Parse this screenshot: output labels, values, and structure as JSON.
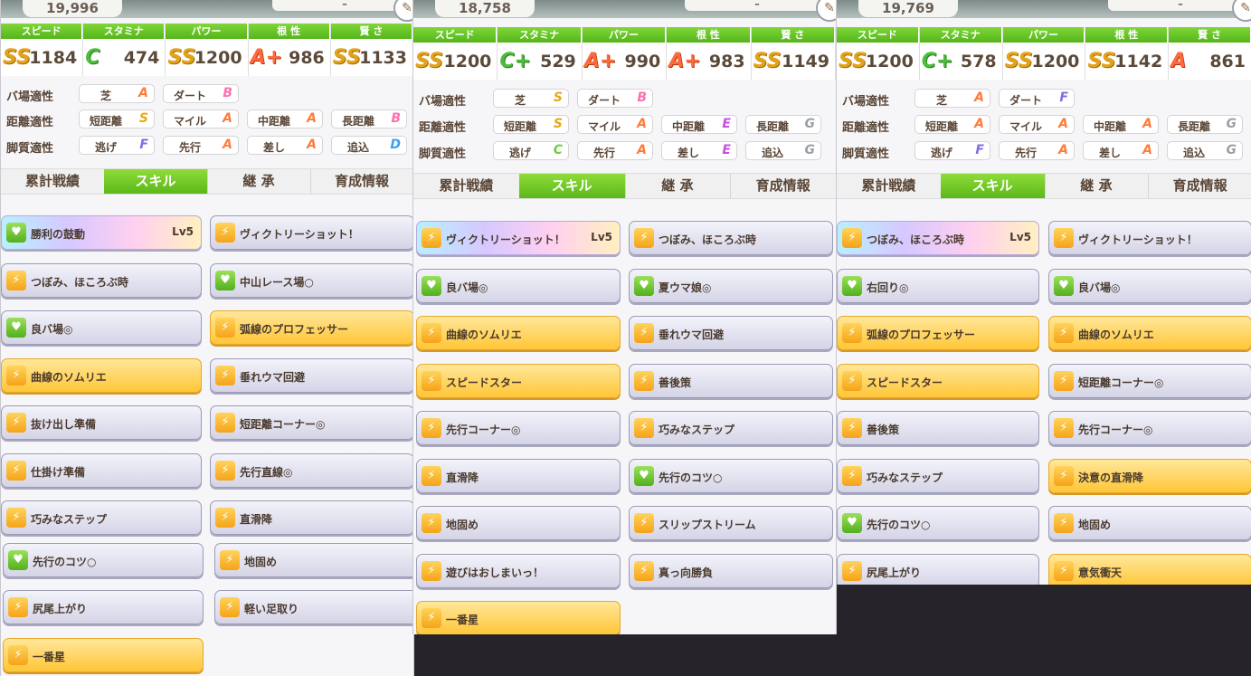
{
  "panels": [
    {
      "score": "19,996",
      "dash": "–",
      "stat_headers": [
        "スピード",
        "スタミナ",
        "パワー",
        "根 性",
        "賢 さ"
      ],
      "stats": [
        {
          "grade": "SS",
          "value": "1184",
          "tone": "gold"
        },
        {
          "grade": "C",
          "value": "474",
          "tone": "gr"
        },
        {
          "grade": "SS",
          "value": "1200",
          "tone": "gold"
        },
        {
          "grade": "A+",
          "value": "986",
          "tone": "or"
        },
        {
          "grade": "SS",
          "value": "1133",
          "tone": "gold"
        }
      ],
      "apt_labels": [
        "バ場適性",
        "距離適性",
        "脚質適性"
      ],
      "apt_rows": [
        [
          {
            "name": "芝",
            "grade": "A"
          },
          {
            "name": "ダート",
            "grade": "B"
          }
        ],
        [
          {
            "name": "短距離",
            "grade": "S"
          },
          {
            "name": "マイル",
            "grade": "A"
          },
          {
            "name": "中距離",
            "grade": "A"
          },
          {
            "name": "長距離",
            "grade": "B"
          }
        ],
        [
          {
            "name": "逃げ",
            "grade": "F"
          },
          {
            "name": "先行",
            "grade": "A"
          },
          {
            "name": "差し",
            "grade": "A"
          },
          {
            "name": "追込",
            "grade": "D"
          }
        ]
      ],
      "tabs": [
        "累計戦績",
        "スキル",
        "継 承",
        "育成情報"
      ],
      "skills": [
        {
          "name": "勝利の鼓動",
          "level": "Lv5",
          "style": "rainbow",
          "icon": "green"
        },
        {
          "name": "ヴィクトリーショット！",
          "style": "plain"
        },
        {
          "name": "つぼみ、ほころぶ時",
          "style": "plain"
        },
        {
          "name": "中山レース場○",
          "style": "plain",
          "icon": "green"
        },
        {
          "name": "良バ場◎",
          "style": "plain",
          "icon": "green"
        },
        {
          "name": "弧線のプロフェッサー",
          "style": "gold"
        },
        {
          "name": "曲線のソムリエ",
          "style": "gold"
        },
        {
          "name": "垂れウマ回避",
          "style": "plain"
        },
        {
          "name": "抜け出し準備",
          "style": "plain"
        },
        {
          "name": "短距離コーナー◎",
          "style": "plain"
        },
        {
          "name": "仕掛け準備",
          "style": "plain"
        },
        {
          "name": "先行直線◎",
          "style": "plain"
        },
        {
          "name": "巧みなステップ",
          "style": "plain"
        },
        {
          "name": "直滑降",
          "style": "plain"
        },
        {
          "name": "先行のコツ○",
          "style": "plain",
          "icon": "green"
        },
        {
          "name": "地固め",
          "style": "plain"
        },
        {
          "name": "尻尾上がり",
          "style": "plain"
        },
        {
          "name": "軽い足取り",
          "style": "plain"
        },
        {
          "name": "一番星",
          "style": "gold"
        }
      ]
    },
    {
      "score": "18,758",
      "dash": "–",
      "stat_headers": [
        "スピード",
        "スタミナ",
        "パワー",
        "根 性",
        "賢 さ"
      ],
      "stats": [
        {
          "grade": "SS",
          "value": "1200",
          "tone": "gold"
        },
        {
          "grade": "C+",
          "value": "529",
          "tone": "gr"
        },
        {
          "grade": "A+",
          "value": "990",
          "tone": "or"
        },
        {
          "grade": "A+",
          "value": "983",
          "tone": "or"
        },
        {
          "grade": "SS",
          "value": "1149",
          "tone": "gold"
        }
      ],
      "apt_labels": [
        "バ場適性",
        "距離適性",
        "脚質適性"
      ],
      "apt_rows": [
        [
          {
            "name": "芝",
            "grade": "S"
          },
          {
            "name": "ダート",
            "grade": "B"
          }
        ],
        [
          {
            "name": "短距離",
            "grade": "S"
          },
          {
            "name": "マイル",
            "grade": "A"
          },
          {
            "name": "中距離",
            "grade": "E"
          },
          {
            "name": "長距離",
            "grade": "G"
          }
        ],
        [
          {
            "name": "逃げ",
            "grade": "C"
          },
          {
            "name": "先行",
            "grade": "A"
          },
          {
            "name": "差し",
            "grade": "E"
          },
          {
            "name": "追込",
            "grade": "G"
          }
        ]
      ],
      "tabs": [
        "累計戦績",
        "スキル",
        "継 承",
        "育成情報"
      ],
      "skills": [
        {
          "name": "ヴィクトリーショット！",
          "level": "Lv5",
          "style": "rainbow"
        },
        {
          "name": "つぼみ、ほころぶ時",
          "style": "plain"
        },
        {
          "name": "良バ場◎",
          "style": "plain",
          "icon": "green"
        },
        {
          "name": "夏ウマ娘◎",
          "style": "plain",
          "icon": "green"
        },
        {
          "name": "曲線のソムリエ",
          "style": "gold"
        },
        {
          "name": "垂れウマ回避",
          "style": "plain"
        },
        {
          "name": "スピードスター",
          "style": "gold"
        },
        {
          "name": "善後策",
          "style": "plain"
        },
        {
          "name": "先行コーナー◎",
          "style": "plain"
        },
        {
          "name": "巧みなステップ",
          "style": "plain"
        },
        {
          "name": "直滑降",
          "style": "plain"
        },
        {
          "name": "先行のコツ○",
          "style": "plain",
          "icon": "green"
        },
        {
          "name": "地固め",
          "style": "plain"
        },
        {
          "name": "スリップストリーム",
          "style": "plain"
        },
        {
          "name": "遊びはおしまいっ！",
          "style": "plain"
        },
        {
          "name": "真っ向勝負",
          "style": "plain"
        },
        {
          "name": "一番星",
          "style": "gold"
        }
      ]
    },
    {
      "score": "19,769",
      "dash": "–",
      "stat_headers": [
        "スピード",
        "スタミナ",
        "パワー",
        "根 性",
        "賢 さ"
      ],
      "stats": [
        {
          "grade": "SS",
          "value": "1200",
          "tone": "gold"
        },
        {
          "grade": "C+",
          "value": "578",
          "tone": "gr"
        },
        {
          "grade": "SS",
          "value": "1200",
          "tone": "gold"
        },
        {
          "grade": "SS",
          "value": "1142",
          "tone": "gold"
        },
        {
          "grade": "A",
          "value": "861",
          "tone": "or"
        }
      ],
      "apt_labels": [
        "バ場適性",
        "距離適性",
        "脚質適性"
      ],
      "apt_rows": [
        [
          {
            "name": "芝",
            "grade": "A"
          },
          {
            "name": "ダート",
            "grade": "F"
          }
        ],
        [
          {
            "name": "短距離",
            "grade": "A"
          },
          {
            "name": "マイル",
            "grade": "A"
          },
          {
            "name": "中距離",
            "grade": "A"
          },
          {
            "name": "長距離",
            "grade": "G"
          }
        ],
        [
          {
            "name": "逃げ",
            "grade": "F"
          },
          {
            "name": "先行",
            "grade": "A"
          },
          {
            "name": "差し",
            "grade": "A"
          },
          {
            "name": "追込",
            "grade": "G"
          }
        ]
      ],
      "tabs": [
        "累計戦績",
        "スキル",
        "継 承",
        "育成情報"
      ],
      "skills": [
        {
          "name": "つぼみ、ほころぶ時",
          "level": "Lv5",
          "style": "rainbow"
        },
        {
          "name": "ヴィクトリーショット！",
          "style": "plain"
        },
        {
          "name": "右回り◎",
          "style": "plain",
          "icon": "green"
        },
        {
          "name": "良バ場◎",
          "style": "plain",
          "icon": "green"
        },
        {
          "name": "弧線のプロフェッサー",
          "style": "gold"
        },
        {
          "name": "曲線のソムリエ",
          "style": "gold"
        },
        {
          "name": "スピードスター",
          "style": "gold"
        },
        {
          "name": "短距離コーナー◎",
          "style": "plain"
        },
        {
          "name": "善後策",
          "style": "plain"
        },
        {
          "name": "先行コーナー◎",
          "style": "plain"
        },
        {
          "name": "巧みなステップ",
          "style": "plain"
        },
        {
          "name": "決意の直滑降",
          "style": "gold"
        },
        {
          "name": "先行のコツ○",
          "style": "plain",
          "icon": "green"
        },
        {
          "name": "地固め",
          "style": "plain"
        },
        {
          "name": "尻尾上がり",
          "style": "plain"
        },
        {
          "name": "意気衝天",
          "style": "gold"
        }
      ]
    }
  ]
}
